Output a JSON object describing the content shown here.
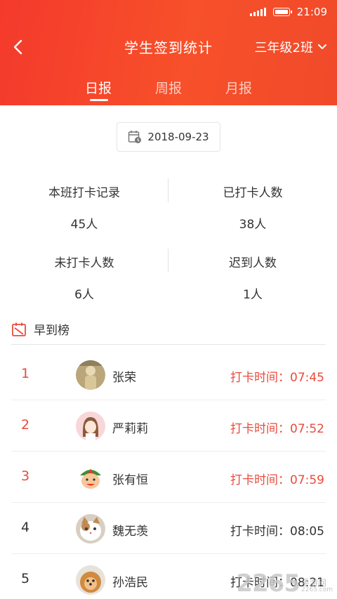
{
  "status_bar": {
    "time": "21:09"
  },
  "header": {
    "title": "学生签到统计",
    "class_selector": "三年级2班"
  },
  "tabs": [
    {
      "label": "日报",
      "active": true
    },
    {
      "label": "周报",
      "active": false
    },
    {
      "label": "月报",
      "active": false
    }
  ],
  "date": "2018-09-23",
  "stats": {
    "class_records": {
      "label": "本班打卡记录",
      "value": "45人"
    },
    "checked_in": {
      "label": "已打卡人数",
      "value": "38人"
    },
    "not_checked_in": {
      "label": "未打卡人数",
      "value": "6人"
    },
    "late": {
      "label": "迟到人数",
      "value": "1人"
    }
  },
  "ranking": {
    "title": "早到榜",
    "items": [
      {
        "rank": "1",
        "name": "张荣",
        "time": "打卡时间：07:45"
      },
      {
        "rank": "2",
        "name": "严莉莉",
        "time": "打卡时间：07:52"
      },
      {
        "rank": "3",
        "name": "张有恒",
        "time": "打卡时间：07:59"
      },
      {
        "rank": "4",
        "name": "魏无羡",
        "time": "打卡时间：08:05"
      },
      {
        "rank": "5",
        "name": "孙浩民",
        "time": "打卡时间：08:21"
      }
    ]
  },
  "watermark": {
    "number": "2265",
    "text_cn": "手游网",
    "text_en": "2265.com"
  },
  "colors": {
    "header": "#f43a2c",
    "accent": "#e94b3c"
  }
}
